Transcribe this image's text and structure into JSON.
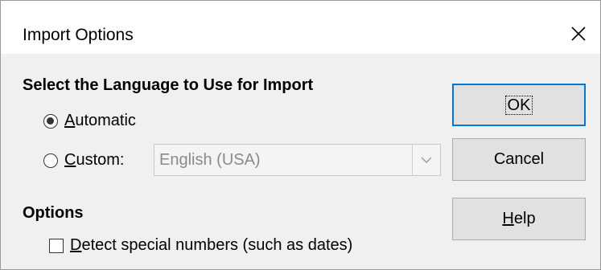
{
  "window": {
    "title": "Import Options",
    "close_symbol": "✕"
  },
  "language_section": {
    "title": "Select the Language to Use for Import",
    "automatic": {
      "mnemonic": "A",
      "rest": "utomatic",
      "selected": true
    },
    "custom": {
      "mnemonic": "C",
      "rest": "ustom:",
      "selected": false
    },
    "language_select": {
      "value": "English (USA)",
      "enabled": false
    }
  },
  "options_section": {
    "title": "Options",
    "detect_numbers": {
      "mnemonic": "D",
      "rest": "etect special numbers (such as dates)",
      "checked": false
    }
  },
  "buttons": {
    "ok": "OK",
    "cancel": "Cancel",
    "help_mnemonic": "H",
    "help_rest": "elp"
  },
  "icons": {
    "close": "close-icon",
    "dropdown": "chevron-down-icon"
  }
}
